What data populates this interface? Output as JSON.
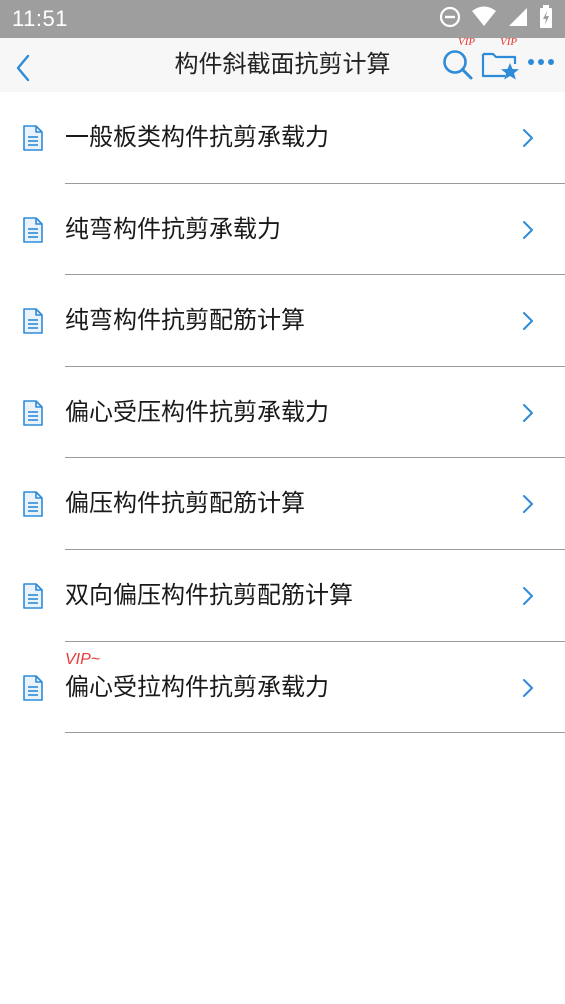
{
  "status_bar": {
    "time": "11:51"
  },
  "app_bar": {
    "title": "构件斜截面抗剪计算",
    "search_vip": "VIP",
    "favorites_vip": "VIP"
  },
  "colors": {
    "accent": "#2e8bd8",
    "vip": "#e53935",
    "status_bar": "#9e9e9e"
  },
  "icons": {
    "back": "chevron-left-icon",
    "search": "search-icon",
    "favorites": "folder-star-icon",
    "more": "more-dots-icon",
    "row": "document-icon",
    "row_arrow": "chevron-right-icon"
  },
  "list": {
    "items": [
      {
        "label": "一般板类构件抗剪承载力",
        "badge": ""
      },
      {
        "label": "纯弯构件抗剪承载力",
        "badge": ""
      },
      {
        "label": "纯弯构件抗剪配筋计算",
        "badge": ""
      },
      {
        "label": "偏心受压构件抗剪承载力",
        "badge": ""
      },
      {
        "label": "偏压构件抗剪配筋计算",
        "badge": ""
      },
      {
        "label": "双向偏压构件抗剪配筋计算",
        "badge": ""
      },
      {
        "label": "偏心受拉构件抗剪承载力",
        "badge": "VIP~"
      }
    ]
  }
}
